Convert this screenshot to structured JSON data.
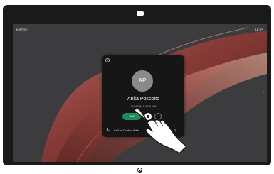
{
  "screen": {
    "top_left_label": "Elena",
    "top_left_chevron": "›",
    "top_right_time": "11:34",
    "side_chevron": "‹"
  },
  "dialog": {
    "avatar_initials": "AP",
    "name": "Anita Poscotto",
    "address": "74145@10.47.8.105",
    "call_label": "Call",
    "call_on_label": "Call on Contact Addr.",
    "next_chevron": "›"
  },
  "colors": {
    "call_button": "#1f8a5a",
    "dialog_bg": "#161616",
    "avatar_bg": "#8a8a8a",
    "wallpaper_accent": "#8b3a35"
  },
  "icons": [
    "close-icon",
    "video-icon",
    "phone-icon",
    "chevron-right-icon",
    "hand-pointer-icon",
    "camera-icon",
    "home-button-icon"
  ]
}
